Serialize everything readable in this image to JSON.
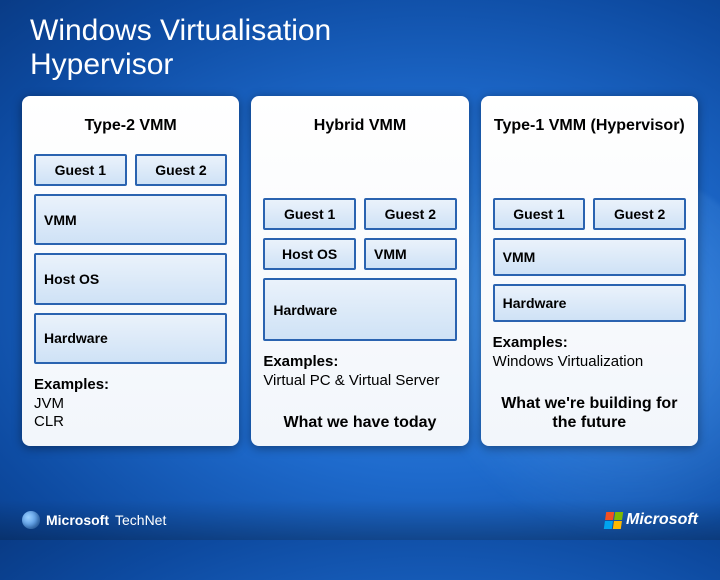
{
  "header": {
    "title": "Windows Virtualisation",
    "subtitle": "Hypervisor"
  },
  "columns": {
    "type2": {
      "title": "Type-2 VMM",
      "guest1": "Guest 1",
      "guest2": "Guest 2",
      "vmm": "VMM",
      "hostos": "Host OS",
      "hardware": "Hardware",
      "examples_label": "Examples:",
      "example1": "JVM",
      "example2": "CLR"
    },
    "hybrid": {
      "title": "Hybrid VMM",
      "guest1": "Guest 1",
      "guest2": "Guest 2",
      "vmm": "VMM",
      "hostos": "Host OS",
      "hardware": "Hardware",
      "examples_label": "Examples:",
      "example_text": "Virtual PC & Virtual Server",
      "callout": "What we have today"
    },
    "type1": {
      "title": "Type-1 VMM (Hypervisor)",
      "guest1": "Guest 1",
      "guest2": "Guest 2",
      "vmm": "VMM",
      "hardware": "Hardware",
      "examples_label": "Examples:",
      "example_text": "Windows Virtualization",
      "callout": "What we're building for the future"
    }
  },
  "footer": {
    "brand": "Microsoft",
    "sub_brand": "TechNet",
    "company": "Microsoft"
  }
}
